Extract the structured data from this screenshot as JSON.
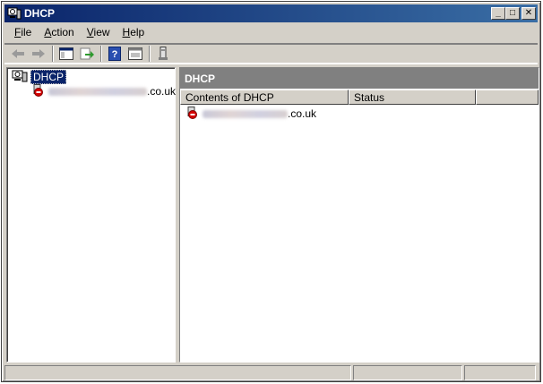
{
  "window": {
    "title": "DHCP",
    "controls": {
      "minimize": "_",
      "maximize": "□",
      "close": "✕"
    }
  },
  "menu": [
    {
      "pre": "",
      "accel": "F",
      "post": "ile"
    },
    {
      "pre": "",
      "accel": "A",
      "post": "ction"
    },
    {
      "pre": "",
      "accel": "V",
      "post": "iew"
    },
    {
      "pre": "",
      "accel": "H",
      "post": "elp"
    }
  ],
  "toolbar_icons": [
    "back-arrow-icon",
    "forward-arrow-icon",
    "show-hide-tree-icon",
    "export-list-icon",
    "help-icon",
    "properties-icon",
    "server-icon"
  ],
  "tree": {
    "root_label": "DHCP",
    "child_suffix": ".co.uk"
  },
  "details": {
    "header": "DHCP",
    "columns": [
      "Contents of DHCP",
      "Status",
      ""
    ],
    "rows": [
      {
        "name_suffix": ".co.uk",
        "status": ""
      }
    ]
  },
  "colors": {
    "titlebar_start": "#0a246a",
    "titlebar_end": "#3a6ea5",
    "pane_header": "#808080",
    "chrome": "#d4d0c8",
    "server_down_red": "#d40000"
  }
}
